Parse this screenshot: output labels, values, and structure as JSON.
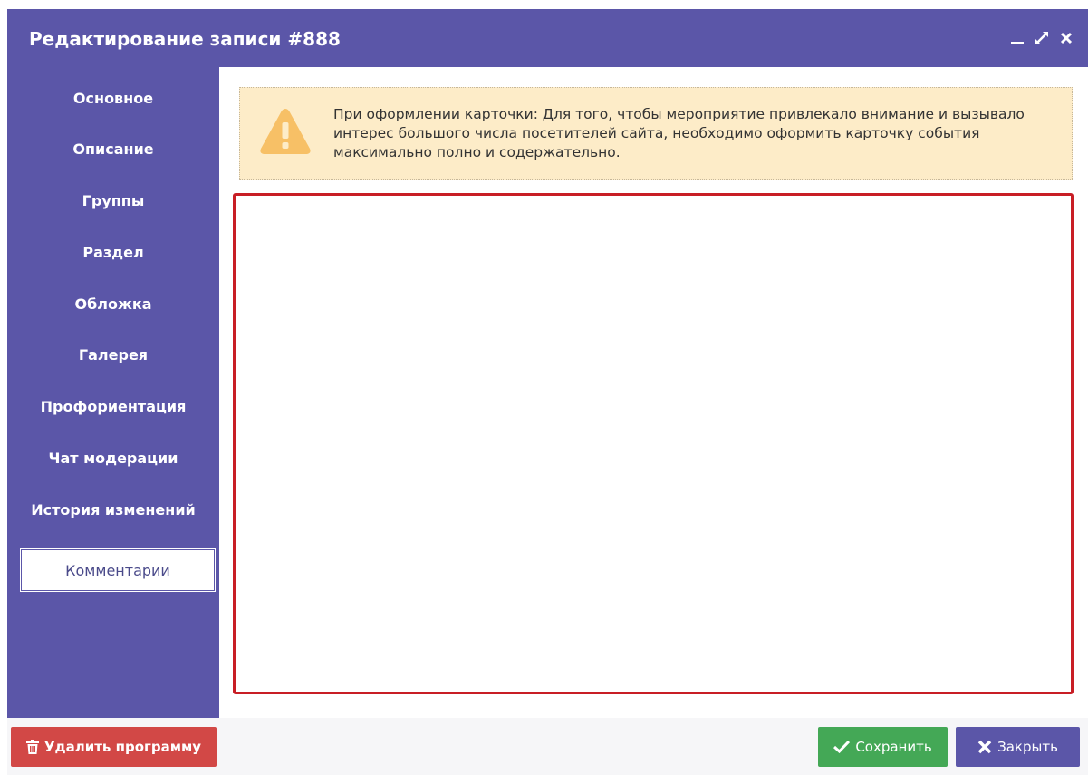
{
  "window": {
    "title": "Редактирование записи #888",
    "controls": {
      "minimize_icon": "minimize-icon",
      "maximize_icon": "expand-icon",
      "close_icon": "close-icon"
    }
  },
  "sidebar": {
    "items": [
      {
        "label": "Основное",
        "active": false
      },
      {
        "label": "Описание",
        "active": false
      },
      {
        "label": "Группы",
        "active": false
      },
      {
        "label": "Раздел",
        "active": false
      },
      {
        "label": "Обложка",
        "active": false
      },
      {
        "label": "Галерея",
        "active": false
      },
      {
        "label": "Профориентация",
        "active": false
      },
      {
        "label": "Чат модерации",
        "active": false
      },
      {
        "label": "История изменений",
        "active": false
      },
      {
        "label": "Комментарии",
        "active": true
      }
    ]
  },
  "alert": {
    "icon": "warning-icon",
    "text": "При оформлении карточки: Для того, чтобы мероприятие привлекало внимание и вызывало интерес большого числа посетителей сайта, необходимо оформить карточку события максимально полно и содержательно."
  },
  "footer": {
    "delete_label": "Удалить программу",
    "save_label": "Сохранить",
    "close_label": "Закрыть"
  },
  "colors": {
    "accent": "#5b56a8",
    "warning_bg": "#fdecc8",
    "warning_icon": "#f7c066",
    "editor_border": "#c81e25",
    "delete": "#d24846",
    "save": "#44a856"
  }
}
